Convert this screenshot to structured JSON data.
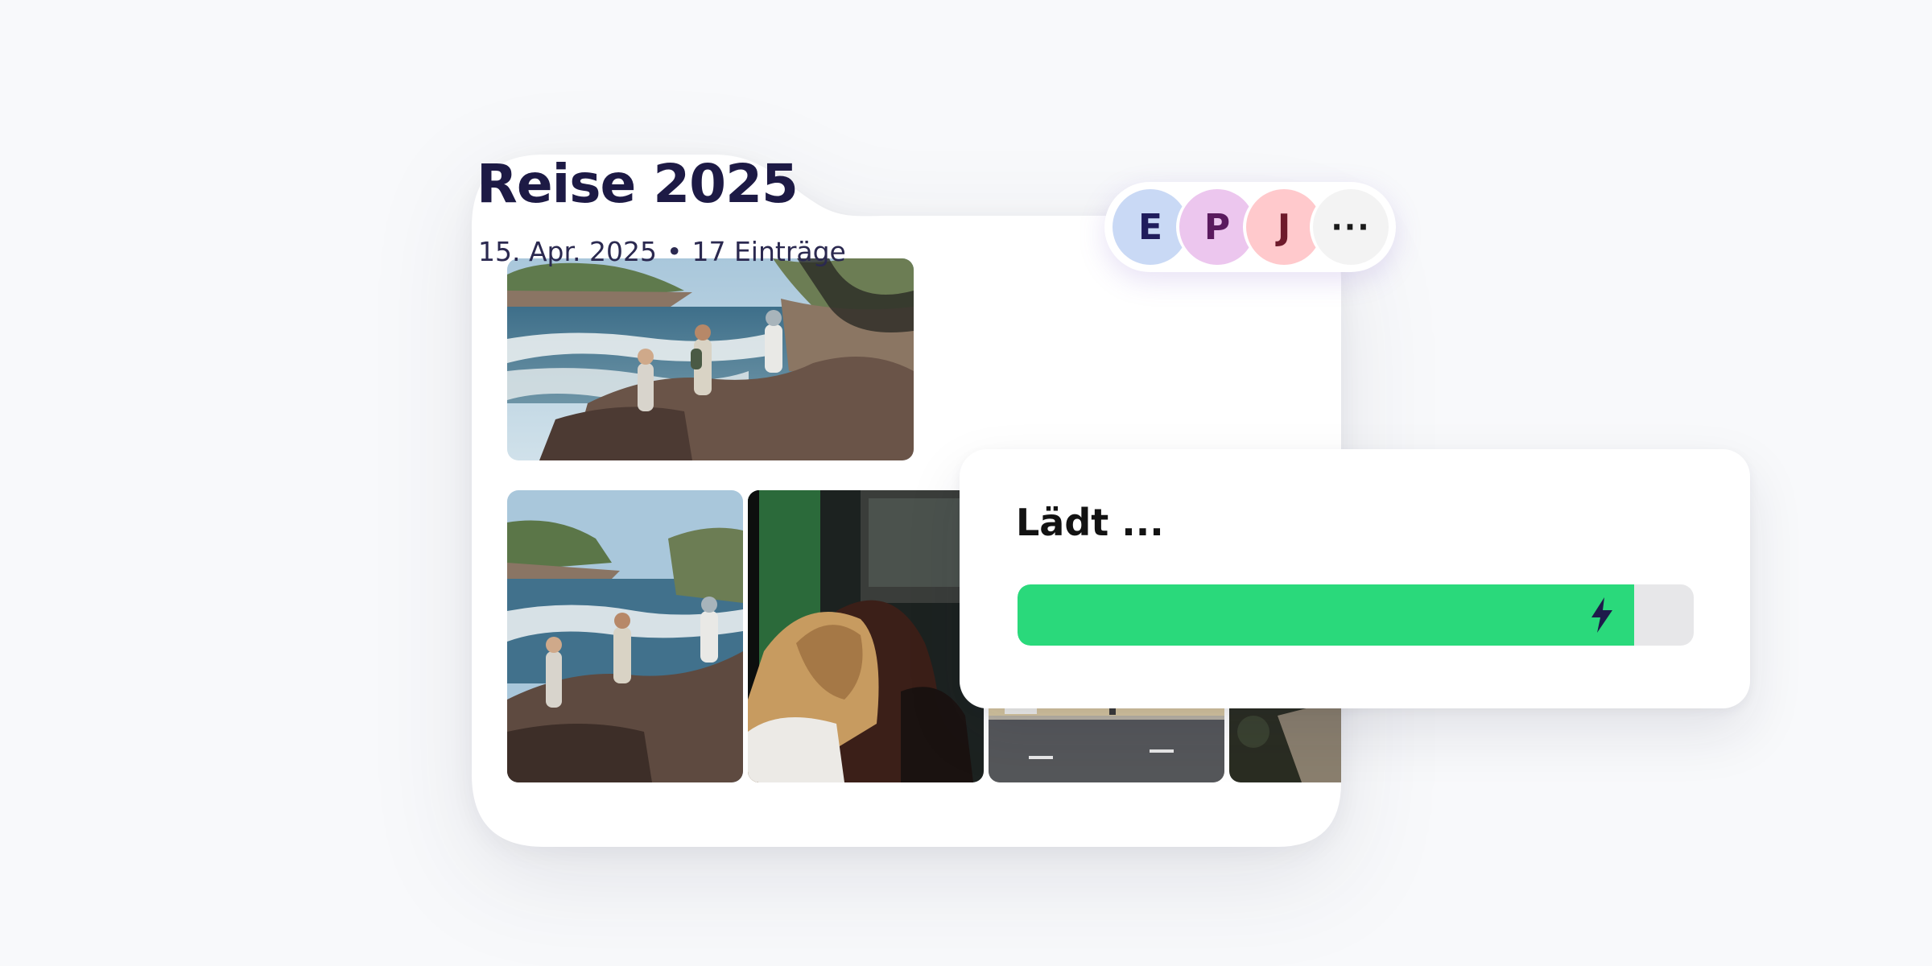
{
  "album": {
    "title": "Reise 2025",
    "date": "15. Apr. 2025",
    "separator": "•",
    "entries": "17 Einträge",
    "photos": [
      {
        "name": "beach-hikers-photo"
      },
      {
        "name": "beach-hikers-photo-2"
      },
      {
        "name": "train-window-women-photo"
      },
      {
        "name": "street-photo"
      },
      {
        "name": "forest-path-photo"
      }
    ]
  },
  "members": {
    "avatars": [
      {
        "initial": "E",
        "bg": "#c9d9f5",
        "fg": "#1f1c5c"
      },
      {
        "initial": "P",
        "bg": "#ecc6ee",
        "fg": "#5a1a5e"
      },
      {
        "initial": "J",
        "bg": "#ffc9cc",
        "fg": "#6e1a2b"
      }
    ],
    "more_label": "···",
    "more_bg": "#f3f3f3"
  },
  "loading": {
    "title": "Lädt ...",
    "progress": 0.912,
    "fill_color": "#2ad97b",
    "track_color": "#e7e7e9",
    "icon": "bolt-icon"
  },
  "colors": {
    "title": "#1d1a45",
    "background": "#f8f9fb"
  }
}
